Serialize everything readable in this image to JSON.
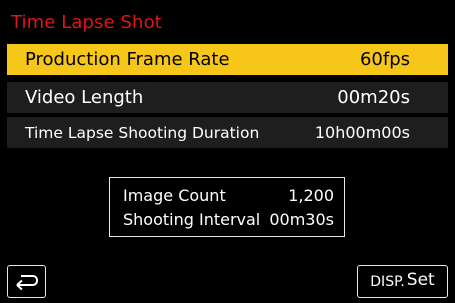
{
  "header": {
    "title": "Time Lapse Shot"
  },
  "menu": {
    "items": [
      {
        "label": "Production Frame Rate",
        "value": "60fps",
        "selected": true
      },
      {
        "label": "Video Length",
        "value": "00m20s",
        "selected": false
      },
      {
        "label": "Time Lapse Shooting Duration",
        "value": "10h00m00s",
        "selected": false
      }
    ]
  },
  "info": {
    "image_count_label": "Image Count",
    "image_count_value": "1,200",
    "interval_label": "Shooting Interval",
    "interval_value": "00m30s"
  },
  "footer": {
    "back_icon": "return-arrow-icon",
    "disp_label": "DISP.",
    "set_label": "Set"
  },
  "colors": {
    "title": "#e11414",
    "selected_background": "#f6c618",
    "row_background": "#1e1e1e",
    "background": "#000000"
  }
}
